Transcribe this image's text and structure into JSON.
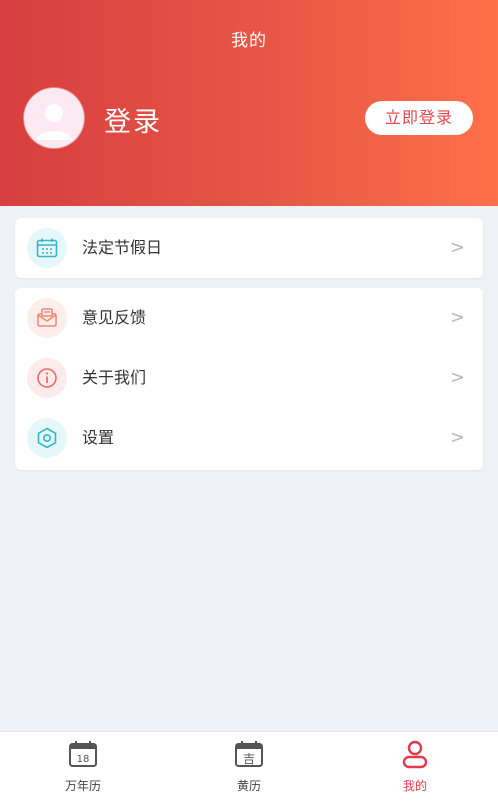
{
  "header": {
    "title": "我的",
    "login_text": "登录",
    "login_button": "立即登录"
  },
  "menu": {
    "holiday": "法定节假日",
    "feedback": "意见反馈",
    "about": "关于我们",
    "settings": "设置",
    "chevron": ">"
  },
  "tabs": {
    "calendar_label": "万年历",
    "calendar_icon_text": "18",
    "almanac_label": "黄历",
    "almanac_icon_text": "吉",
    "mine_label": "我的"
  },
  "colors": {
    "header_start": "#d83e40",
    "header_end": "#ff7048",
    "accent_red": "#e23b4b",
    "teal": "#33b7c6"
  }
}
